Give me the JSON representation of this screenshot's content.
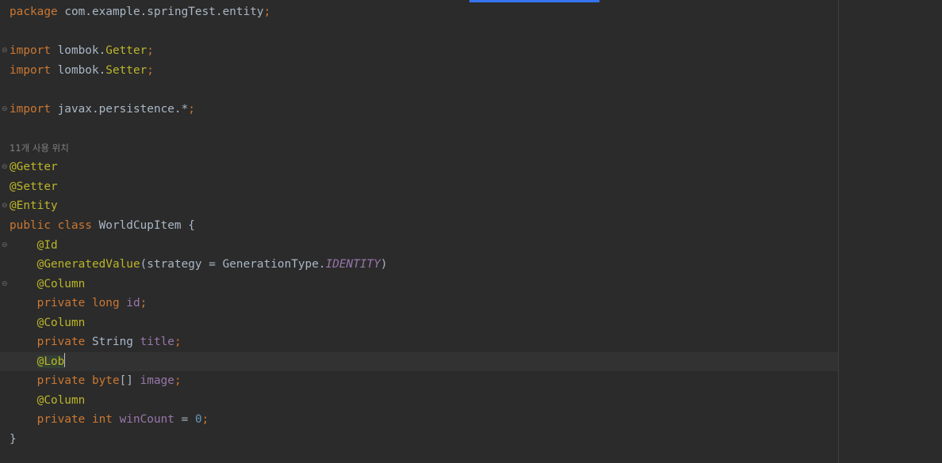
{
  "code": {
    "package_kw": "package",
    "package_name": " com.example.springTest.entity",
    "semi": ";",
    "import_kw": "import",
    "import1_pkg": " lombok.",
    "import1_cls": "Getter",
    "import2_pkg": " lombok.",
    "import2_cls": "Setter",
    "import3_pkg": " javax.persistence.*",
    "usage_hint": "11개 사용 위치",
    "ann_getter": "@Getter",
    "ann_setter": "@Setter",
    "ann_entity": "@Entity",
    "public_kw": "public",
    "class_kw": " class",
    "class_name": " WorldCupItem {",
    "indent": "    ",
    "ann_id": "@Id",
    "ann_generated": "@GeneratedValue",
    "gen_args_pre": "(strategy = GenerationType.",
    "gen_const": "IDENTITY",
    "gen_args_post": ")",
    "ann_column": "@Column",
    "private_kw": "private",
    "long_kw": " long",
    "field_id": " id",
    "string_type": " String",
    "field_title": " title",
    "ann_lob": "@Lob",
    "byte_kw": " byte",
    "byte_brackets": "[]",
    "field_image": " image",
    "int_kw": " int",
    "field_wincount": " winCount",
    "assign": " = ",
    "zero": "0",
    "close_brace": "}"
  }
}
